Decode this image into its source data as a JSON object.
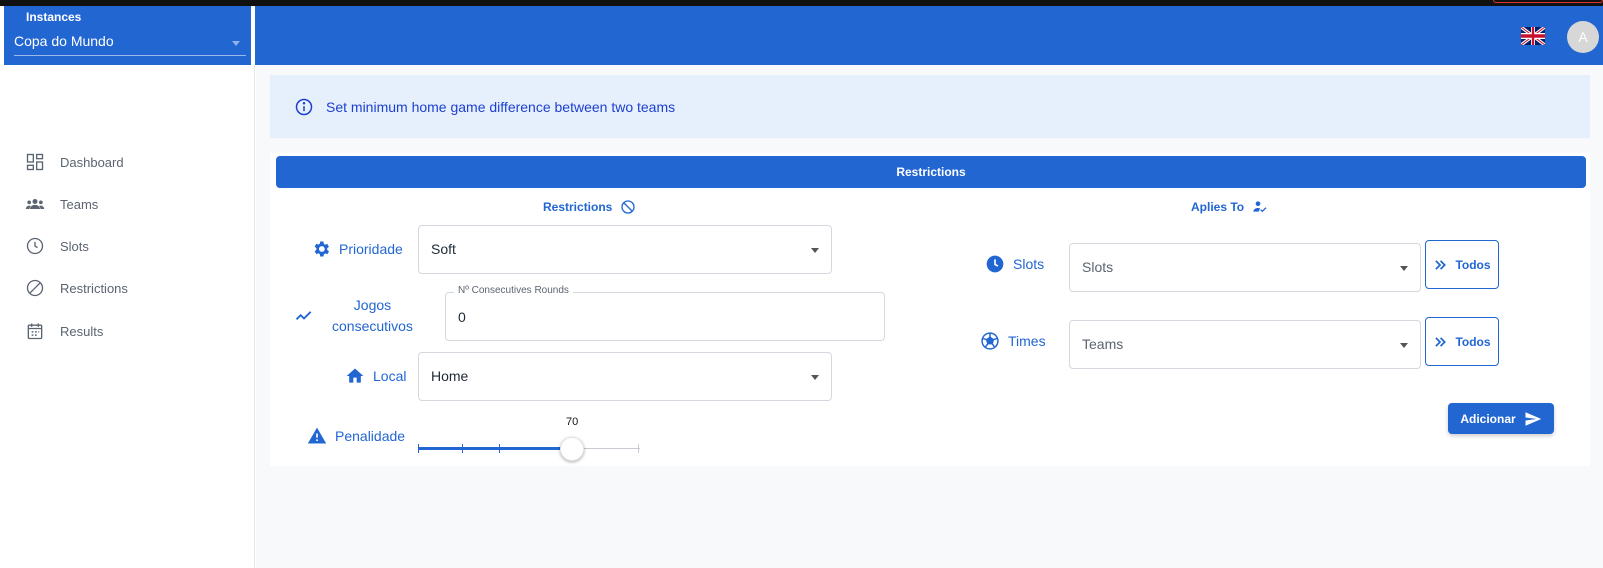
{
  "instances": {
    "label": "Instances",
    "selected": "Copa do Mundo"
  },
  "header": {
    "avatar_initial": "A",
    "flag": "uk-flag-icon"
  },
  "sidebar": {
    "items": [
      {
        "label": "Dashboard",
        "icon": "dashboard-icon"
      },
      {
        "label": "Teams",
        "icon": "groups-icon"
      },
      {
        "label": "Slots",
        "icon": "clock-icon"
      },
      {
        "label": "Restrictions",
        "icon": "block-icon"
      },
      {
        "label": "Results",
        "icon": "calendar-icon"
      }
    ]
  },
  "info_banner": {
    "text": "Set minimum home game difference between two teams",
    "icon": "info-icon"
  },
  "card": {
    "header": "Restrictions",
    "left": {
      "title": "Restrictions",
      "prioridade": {
        "label": "Prioridade",
        "value": "Soft"
      },
      "jogos": {
        "label_line1": "Jogos",
        "label_line2": "consecutivos",
        "field_legend": "Nº Consecutives Rounds",
        "value": "0"
      },
      "local": {
        "label": "Local",
        "value": "Home"
      },
      "penalidade": {
        "label": "Penalidade",
        "value": "70",
        "level_percent": 70
      }
    },
    "right": {
      "title": "Aplies To",
      "slots": {
        "label": "Slots",
        "placeholder": "Slots",
        "button": "Todos"
      },
      "times": {
        "label": "Times",
        "placeholder": "Teams",
        "button": "Todos"
      }
    },
    "add_button": "Adicionar"
  },
  "colors": {
    "primary": "#2266d2",
    "info_bg": "#e6f0fd",
    "info_text": "#1d3fcf"
  }
}
